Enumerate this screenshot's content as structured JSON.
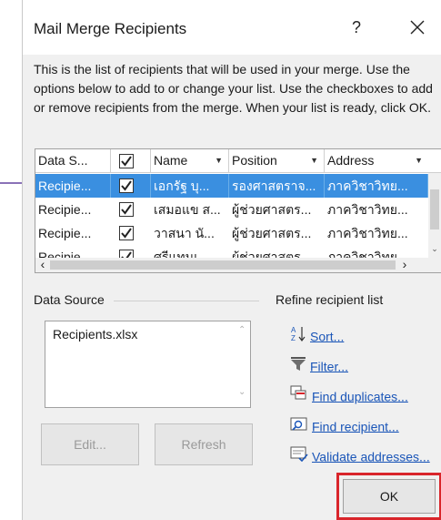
{
  "dialog": {
    "title": "Mail Merge Recipients",
    "help_label": "?",
    "intro_text": "This is the list of recipients that will be used in your merge.  Use the options below to add to or change your list.  Use the checkboxes to add or remove recipients from the merge.  When your list is ready, click OK."
  },
  "grid": {
    "columns": [
      {
        "label": "Data S...",
        "has_dropdown": false
      },
      {
        "label": "",
        "checkbox": true,
        "checked": true
      },
      {
        "label": "Name",
        "has_dropdown": true
      },
      {
        "label": "Position",
        "has_dropdown": true
      },
      {
        "label": "Address",
        "has_dropdown": true
      }
    ],
    "rows": [
      {
        "source": "Recipie...",
        "checked": true,
        "name": "เอกรัฐ บุ...",
        "position": "รองศาสตราจ...",
        "address": "ภาควิชาวิทย...",
        "selected": true
      },
      {
        "source": "Recipie...",
        "checked": true,
        "name": "เสมอแข ส...",
        "position": "ผู้ช่วยศาสตร...",
        "address": "ภาควิชาวิทย...",
        "selected": false
      },
      {
        "source": "Recipie...",
        "checked": true,
        "name": "วาสนา  นั...",
        "position": "ผู้ช่วยศาสตร...",
        "address": "ภาควิชาวิทย...",
        "selected": false
      },
      {
        "source": "Recipie",
        "checked": true,
        "name": "ศรีแทนเ...",
        "position": "ผู้ช่วยศาสตร...",
        "address": "ภาควิชาวิทย...",
        "selected": false
      }
    ]
  },
  "data_source": {
    "group_label": "Data Source",
    "items": [
      "Recipients.xlsx"
    ],
    "edit_label": "Edit...",
    "refresh_label": "Refresh"
  },
  "refine": {
    "group_label": "Refine recipient list",
    "sort_label": "Sort...",
    "filter_label": "Filter...",
    "find_duplicates_label": "Find duplicates...",
    "find_recipient_label": "Find recipient...",
    "validate_label": "Validate addresses..."
  },
  "ok_label": "OK",
  "colors": {
    "selection": "#3a8fe0",
    "link": "#1b56b8",
    "highlight_box": "#d9252b",
    "pointer_arrow": "#8a72b7"
  }
}
